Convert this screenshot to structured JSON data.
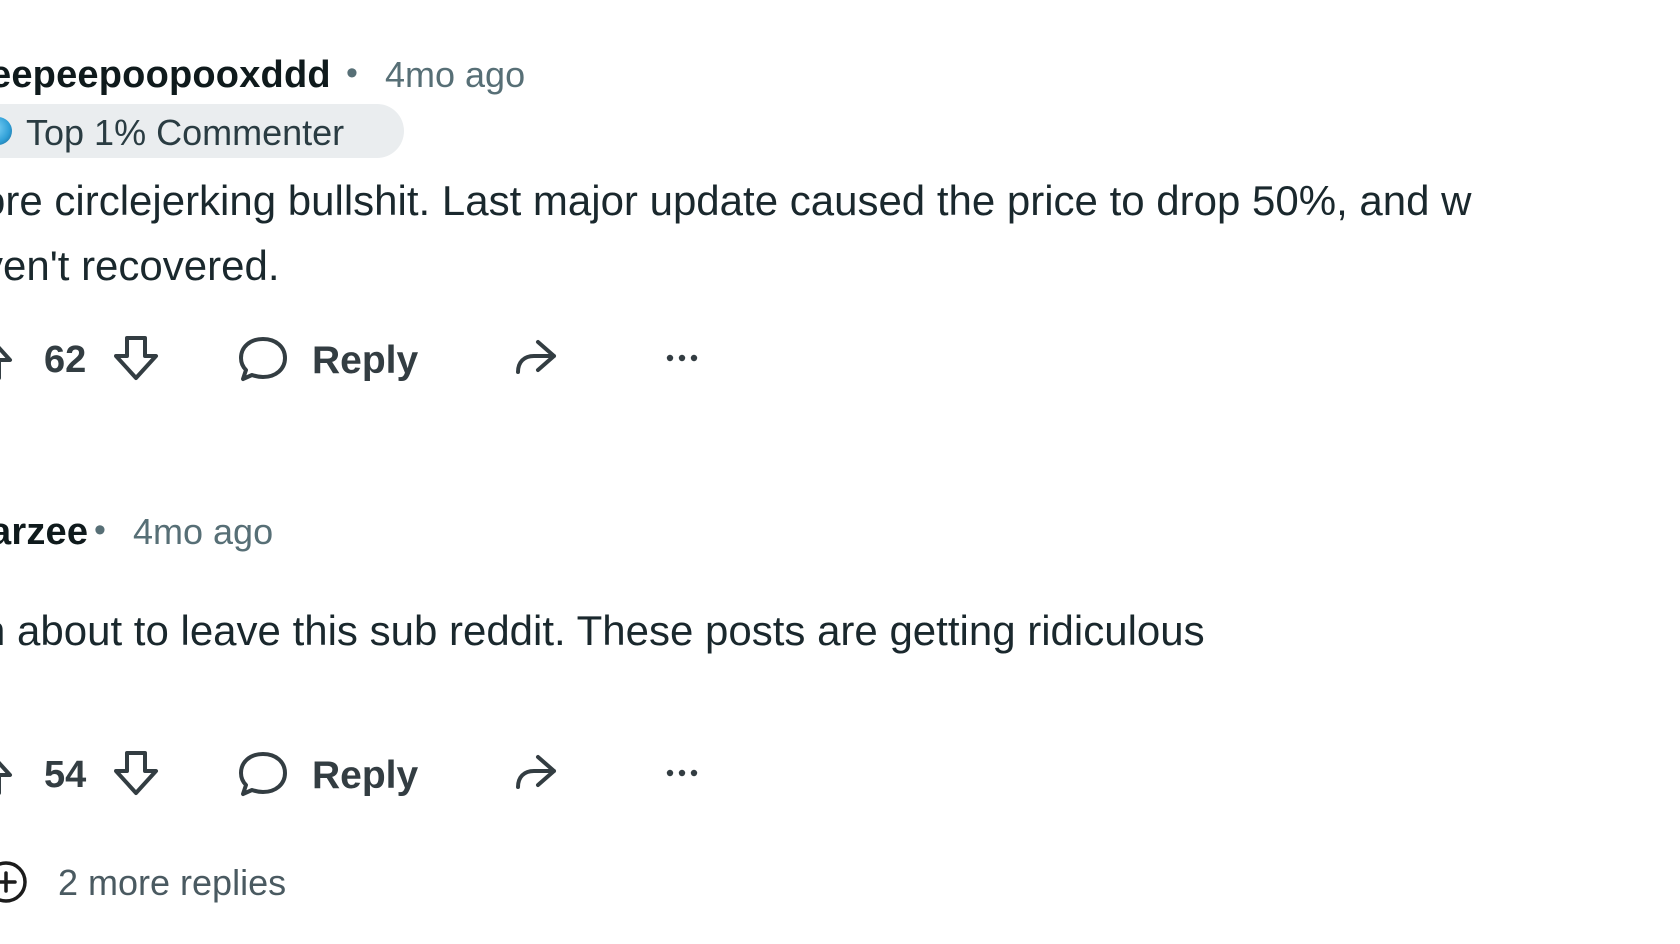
{
  "comments": [
    {
      "author": "eepeepoopooxddd",
      "separator": "•",
      "time": "4mo ago",
      "flair": "Top 1% Commenter",
      "body": "ore circlejerking bullshit. Last major update caused the price to drop 50%, and w\nven't recovered.",
      "score": "62",
      "reply_label": "Reply"
    },
    {
      "author": "arzee",
      "separator": "•",
      "time": "4mo ago",
      "body": "n about to leave this sub reddit. These posts are getting ridiculous",
      "score": "54",
      "reply_label": "Reply"
    }
  ],
  "more_replies": "2 more replies",
  "icons": {
    "upvote": "upvote-icon",
    "downvote": "downvote-icon",
    "reply": "comment-bubble-icon",
    "share": "share-icon",
    "more": "more-options-icon",
    "expand": "plus-circle-icon",
    "flair": "commenter-badge-icon"
  },
  "colors": {
    "text": "#1a282d",
    "muted": "#576f76",
    "flair_bg": "#eaedef",
    "icon": "#333d42"
  }
}
